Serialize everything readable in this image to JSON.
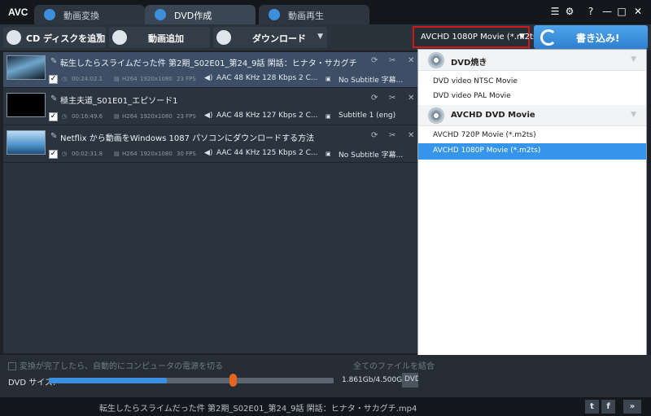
{
  "app": {
    "logo": "AVC"
  },
  "tabs": [
    {
      "label": "動画変換",
      "active": false
    },
    {
      "label": "DVD作成",
      "active": true
    },
    {
      "label": "動画再生",
      "active": false
    }
  ],
  "window_controls": {
    "help": "?",
    "minimize": "—",
    "maximize": "□",
    "close": "✕"
  },
  "toolbar": {
    "add_cd_label": "CD ディスクを追加",
    "add_video_label": "動画追加",
    "download_label": "ダウンロード"
  },
  "profile": {
    "selected": "AVCHD 1080P Movie (*.m2ts)"
  },
  "burn_button": {
    "label": "書き込み!"
  },
  "files": [
    {
      "name": "転生したらスライムだった件 第2期_S02E01_第24_9話 閑話：ヒナタ・サカグチ",
      "duration": "00:24:02.1",
      "codec": "H264",
      "resolution": "1920x1080",
      "fps": "23 FPS",
      "audio": "AAC 48 KHz 128 Kbps 2 C...",
      "subtitle": "No Subtitle 字幕...",
      "checked": true,
      "selected": true
    },
    {
      "name": "極主夫道_S01E01_エピソード1",
      "duration": "00:16:49.6",
      "codec": "H264",
      "resolution": "1920x1080",
      "fps": "23 FPS",
      "audio": "AAC 48 KHz 127 Kbps 2 C...",
      "subtitle": "Subtitle 1 (eng)",
      "checked": true,
      "selected": false
    },
    {
      "name": "Netflix から動画をWindows 1087 パソコンにダウンロードする方法",
      "duration": "00:02:31.8",
      "codec": "H264",
      "resolution": "1920x1080",
      "fps": "30 FPS",
      "audio": "AAC 44 KHz 125 Kbps 2 C...",
      "subtitle": "No Subtitle 字幕...",
      "checked": true,
      "selected": false
    }
  ],
  "profile_panel": {
    "groups": [
      {
        "title": "DVD焼き",
        "options": [
          "DVD video NTSC Movie",
          "DVD video PAL Movie"
        ]
      },
      {
        "title": "AVCHD DVD Movie",
        "options": [
          "AVCHD 720P Movie (*.m2ts)",
          "AVCHD 1080P Movie (*.m2ts)"
        ]
      }
    ],
    "selected_option": "AVCHD 1080P Movie (*.m2ts)"
  },
  "bottom": {
    "shutdown_label": "変換が完了したら、自動的にコンピュータの電源を切る",
    "merge_label": "全てのファイルを結合",
    "dvd_size_label": "DVD サイズ:",
    "size_text": "1.861Gb/4.500Gb",
    "size_fraction": 0.414,
    "dvd_button_label": "DVD"
  },
  "status": {
    "current_file": "転生したらスライムだった件 第2期_S02E01_第24_9話 閑話：ヒナタ・サカグチ.mp4",
    "next_label": "»"
  },
  "colors": {
    "accent": "#3595ea",
    "highlight_border": "#d01818",
    "selected_row": "#3c4f66"
  }
}
